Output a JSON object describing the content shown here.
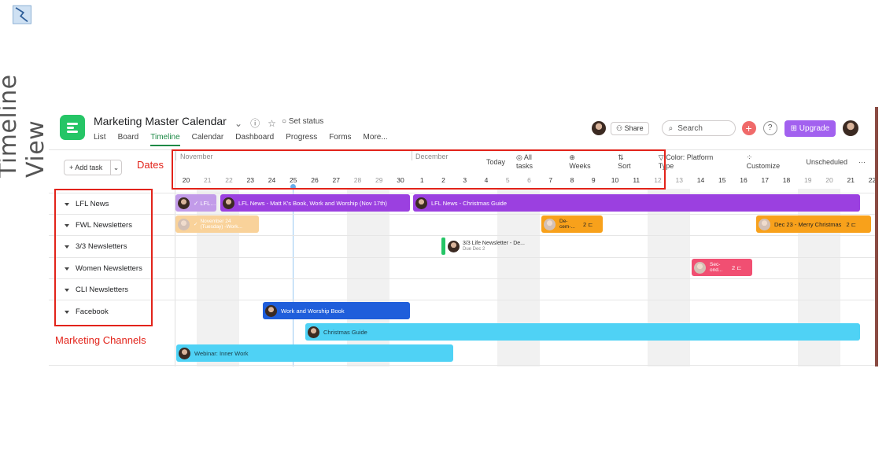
{
  "caption": {
    "text": "Timeline View",
    "icon": "timeline-icon"
  },
  "annotations": {
    "dates_label": "Dates",
    "channels_label": "Marketing Channels",
    "color": "#e2231a"
  },
  "header": {
    "project_title": "Marketing Master Calendar",
    "set_status": "Set status",
    "tabs": [
      "List",
      "Board",
      "Timeline",
      "Calendar",
      "Dashboard",
      "Progress",
      "Forms",
      "More..."
    ],
    "active_tab": "Timeline",
    "share": "Share",
    "search_placeholder": "Search",
    "plus": "+",
    "help": "?",
    "upgrade": "Upgrade"
  },
  "add_task": {
    "label": "+ Add task"
  },
  "months": [
    "November",
    "December"
  ],
  "toolbar": {
    "today": "Today",
    "all_tasks": "All tasks",
    "weeks": "Weeks",
    "sort": "Sort",
    "color": "Color: Platform Type",
    "customize": "Customize",
    "unscheduled": "Unscheduled",
    "more": "···"
  },
  "days": [
    "20",
    "21",
    "22",
    "23",
    "24",
    "25",
    "26",
    "27",
    "28",
    "29",
    "30",
    "1",
    "2",
    "3",
    "4",
    "5",
    "6",
    "7",
    "8",
    "9",
    "10",
    "11",
    "12",
    "13",
    "14",
    "15",
    "16",
    "17",
    "18",
    "19",
    "20",
    "21",
    "22"
  ],
  "sections": [
    "LFL News",
    "FWL Newsletters",
    "3/3 Newsletters",
    "Women Newsletters",
    "CLI Newsletters",
    "Facebook"
  ],
  "tasks": {
    "lfl_a": "LFL News",
    "lfl_b": "LFL News - Matt K's Book, Work and Worship (Nov 17th)",
    "lfl_c": "LFL News - Christmas Guide",
    "fwl_a_line1": "November 24",
    "fwl_a_line2": "(Tuesday) -Work...",
    "fwl_b": "De-cem-...",
    "fwl_b_sub": "2",
    "fwl_c": "Dec 23 - Merry Christmas",
    "fwl_c_sub": "2",
    "three_a": "3/3 Life Newsletter - De...",
    "three_a_due": "Due Dec 2",
    "women_a": "Sec-ond...",
    "women_a_sub": "2",
    "fb_a": "Work and Worship Book",
    "fb_b": "Christmas Guide",
    "fb_c": "Webinar: Inner Work"
  },
  "colors": {
    "purple": "#9b40e0",
    "purple_light": "#c29be9",
    "orange": "#f8a11b",
    "orange_light": "#f9d29a",
    "pink": "#f14f72",
    "blue": "#1f5edb",
    "cyan": "#4fd2f5",
    "green": "#25c566"
  }
}
